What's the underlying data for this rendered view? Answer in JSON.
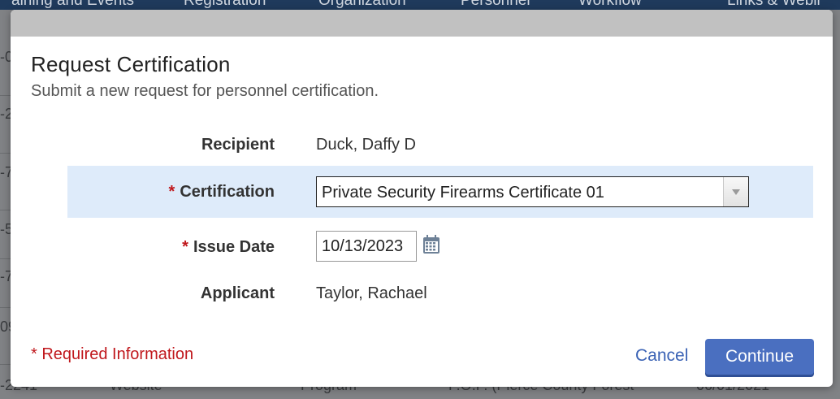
{
  "background": {
    "nav_tabs": [
      "aining and Events",
      "Registration",
      "Organization",
      "Personnel",
      "Workflow",
      "Links & Webli"
    ],
    "row_fragments": [
      "-0",
      "-2",
      "-7",
      "-5",
      "-7",
      "09",
      "-2241",
      "Website",
      "Program",
      "P.O.P. (Pierce County Forest",
      "06/01/2021"
    ]
  },
  "dialog": {
    "title": "Request Certification",
    "subtitle": "Submit a new request for personnel certification.",
    "fields": {
      "recipient": {
        "label": "Recipient",
        "value": "Duck, Daffy D"
      },
      "certification": {
        "required_mark": "*",
        "label": "Certification",
        "value": "Private Security Firearms Certificate 01"
      },
      "issue_date": {
        "required_mark": "*",
        "label": "Issue Date",
        "value": "10/13/2023",
        "icon": "calendar-icon"
      },
      "applicant": {
        "label": "Applicant",
        "value": "Taylor, Rachael"
      }
    },
    "required_note": "* Required Information",
    "cancel_label": "Cancel",
    "continue_label": "Continue"
  },
  "colors": {
    "accent": "#4a6fc0",
    "required": "#c0171c",
    "highlight_row": "#deebfa",
    "link": "#3b63b5"
  }
}
